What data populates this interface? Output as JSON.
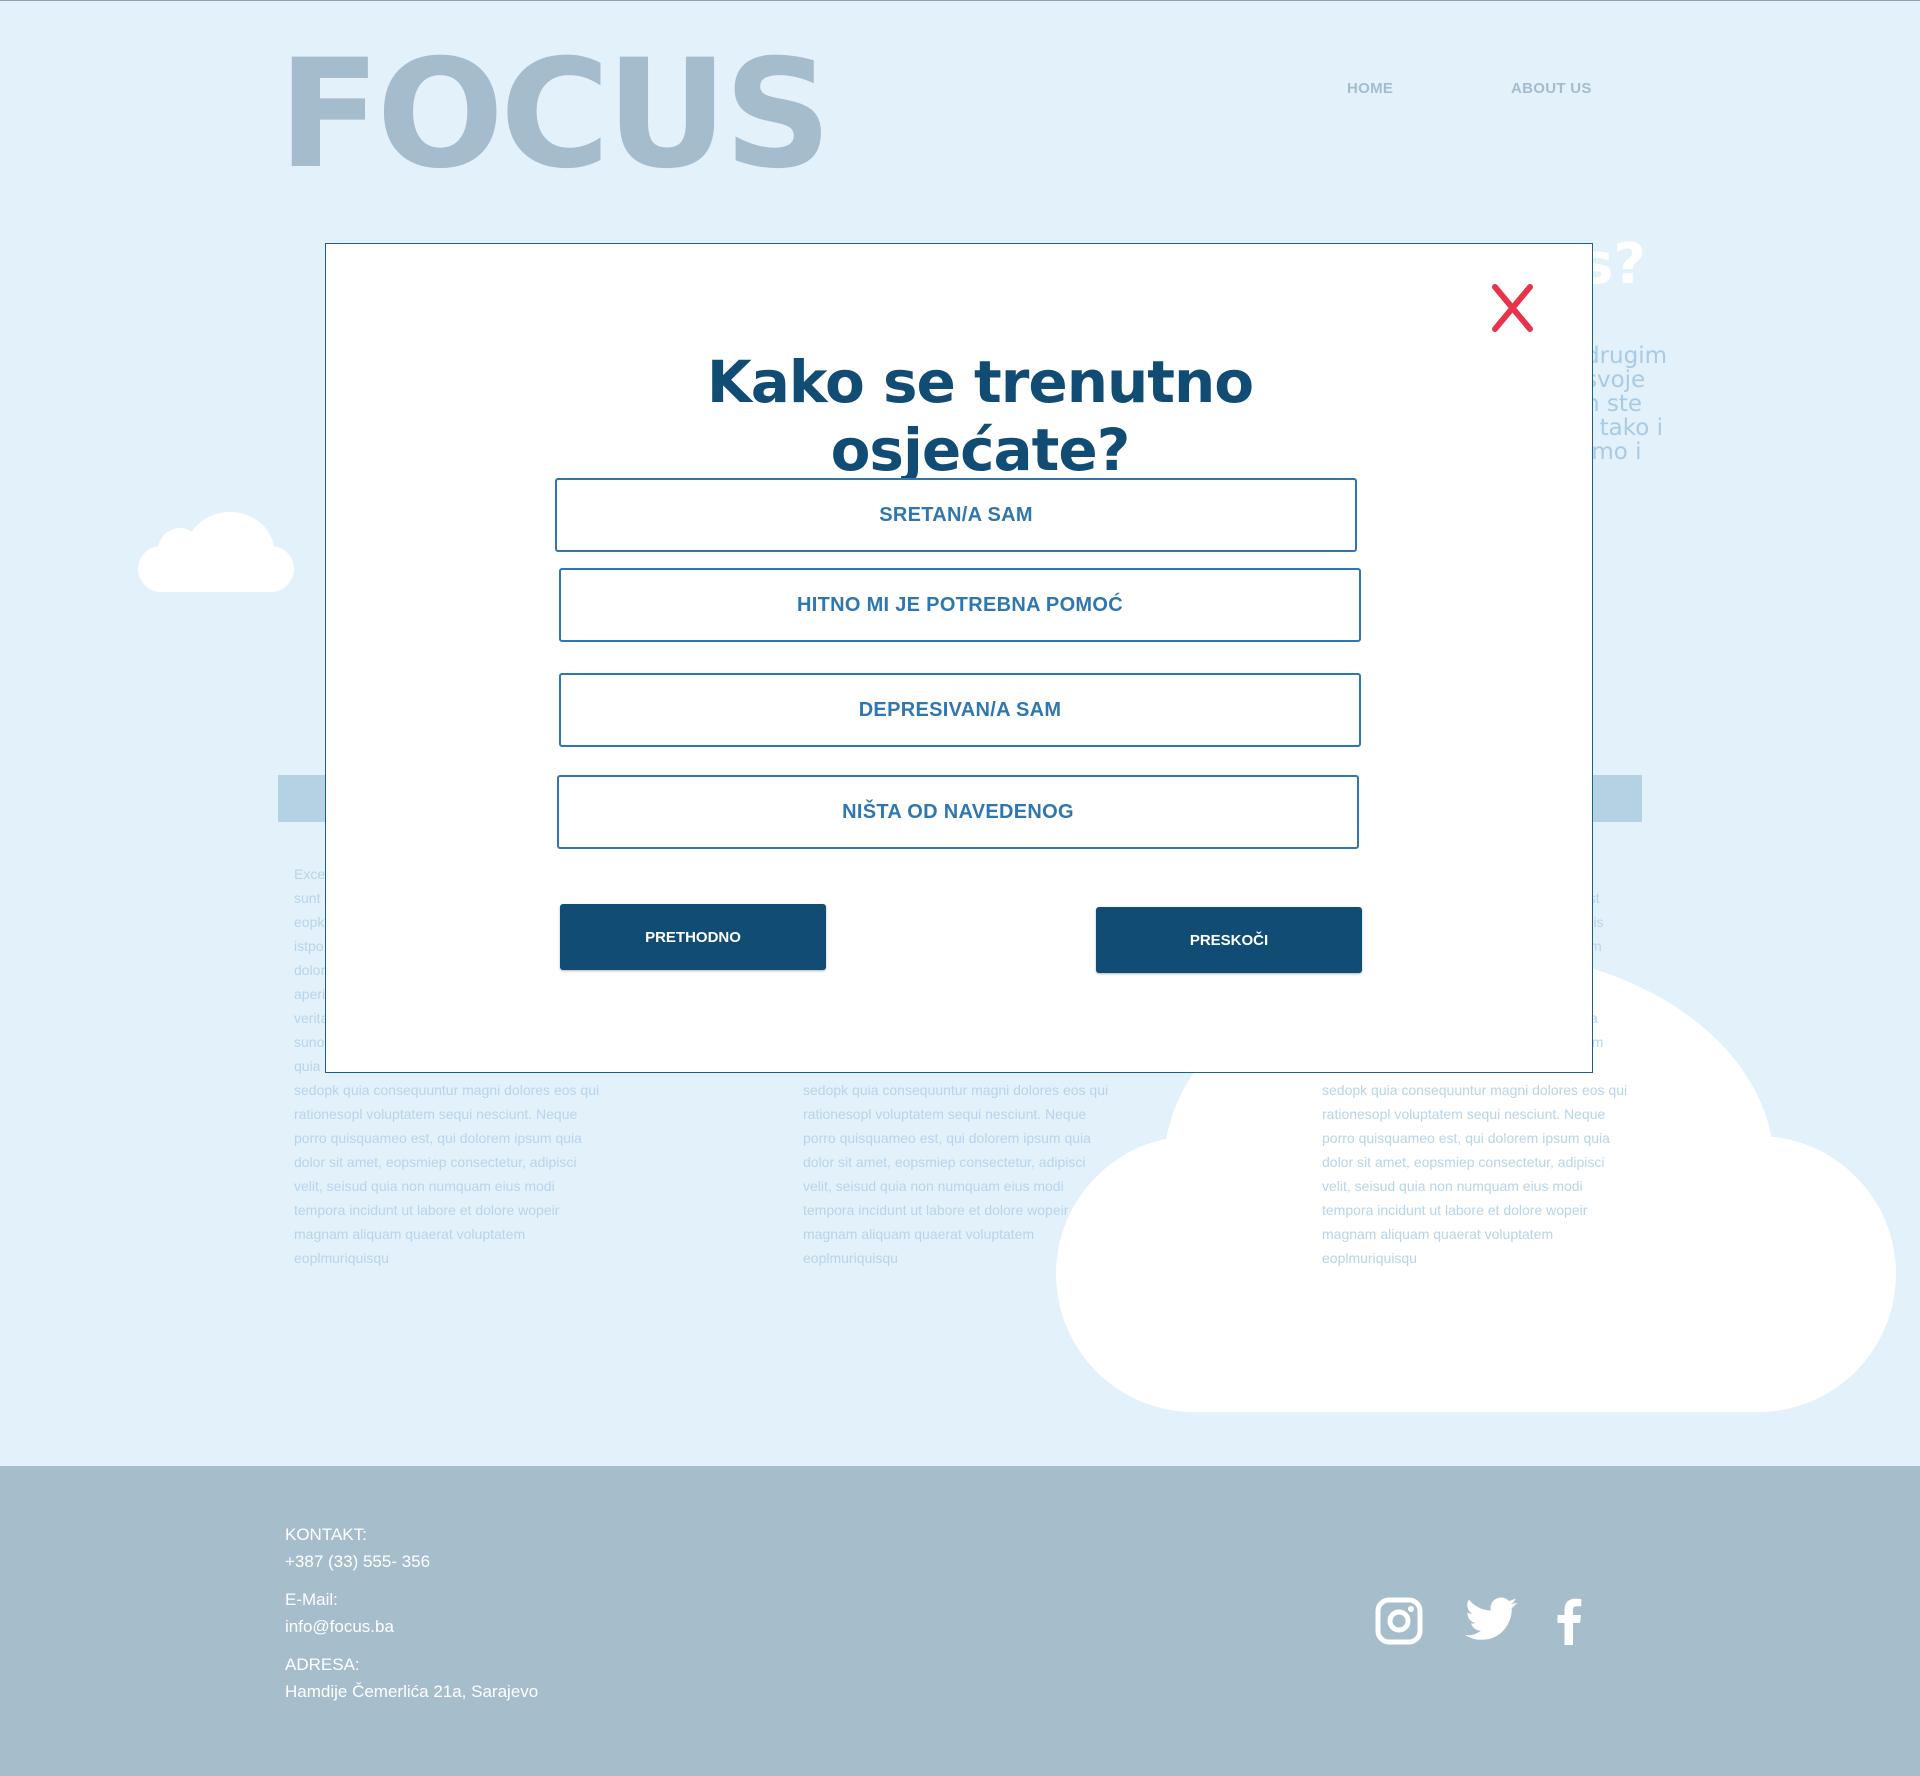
{
  "header": {
    "logo": "FOCUS",
    "nav": [
      "HOME",
      "ABOUT US"
    ]
  },
  "background_section": {
    "heading_fragment": "s?",
    "intro_fragments": [
      "drugim",
      "svoje",
      "n ste",
      ", tako i",
      "imo i"
    ],
    "columns": [
      {
        "lines": [
          "Exce",
          "sunt",
          "eopk",
          "istpo",
          "dolor",
          "aperi",
          "verita",
          "sunod",
          "quia",
          "sedopk quia consequuntur magni dolores eos qui",
          "rationesopl voluptatem sequi nesciunt. Neque",
          "porro quisquameo est, qui dolorem ipsum quia",
          "dolor sit amet, eopsmiep consectetur, adipisci",
          "velit, seisud quia non numquam eius modi",
          "tempora incidunt ut labore et dolore wopeir",
          "magnam aliquam quaerat voluptatem",
          "eoplmuriquisqu"
        ]
      },
      {
        "lines": [
          "sedopk quia consequuntur magni dolores eos qui",
          "rationesopl voluptatem sequi nesciunt. Neque",
          "porro quisquameo est, qui dolorem ipsum quia",
          "dolor sit amet, eopsmiep consectetur, adipisci",
          "velit, seisud quia non numquam eius modi",
          "tempora incidunt ut labore et dolore wopeir",
          "magnam aliquam quaerat voluptatem",
          "eoplmuriquisqu"
        ]
      },
      {
        "lines": [
          "ent,",
          "id est",
          "mnis",
          "m",
          "",
          "",
          "a",
          "em",
          "",
          "sedopk quia consequuntur magni dolores eos qui",
          "rationesopl voluptatem sequi nesciunt. Neque",
          "porro quisquameo est, qui dolorem ipsum quia",
          "dolor sit amet, eopsmiep consectetur, adipisci",
          "velit, seisud quia non numquam eius modi",
          "tempora incidunt ut labore et dolore wopeir",
          "magnam aliquam quaerat voluptatem",
          "eoplmuriquisqu"
        ]
      }
    ]
  },
  "modal": {
    "title": "Kako se trenutno osjećate?",
    "close_icon": "close-x-icon",
    "options": [
      "SRETAN/A SAM",
      "HITNO MI JE POTREBNA POMOĆ",
      "DEPRESIVAN/A SAM",
      "NIŠTA OD NAVEDENOG"
    ],
    "prev_label": "PRETHODNO",
    "skip_label": "PRESKOČI"
  },
  "footer": {
    "contact_label": "KONTAKT:",
    "phone": "+387 (33) 555- 356",
    "email_label": "E-Mail:",
    "email": "info@focus.ba",
    "address_label": "ADRESA:",
    "address": "Hamdije Čemerlića 21a, Sarajevo",
    "social_icons": [
      "instagram-icon",
      "twitter-icon",
      "facebook-icon"
    ]
  },
  "colors": {
    "page_bg": "#e3f1fb",
    "logo": "#a4bccb",
    "modal_title": "#114c74",
    "option_border": "#2e77b0",
    "action_button": "#114c74",
    "close_x": "#e8334a",
    "footer_bg": "#a6bdcb"
  }
}
